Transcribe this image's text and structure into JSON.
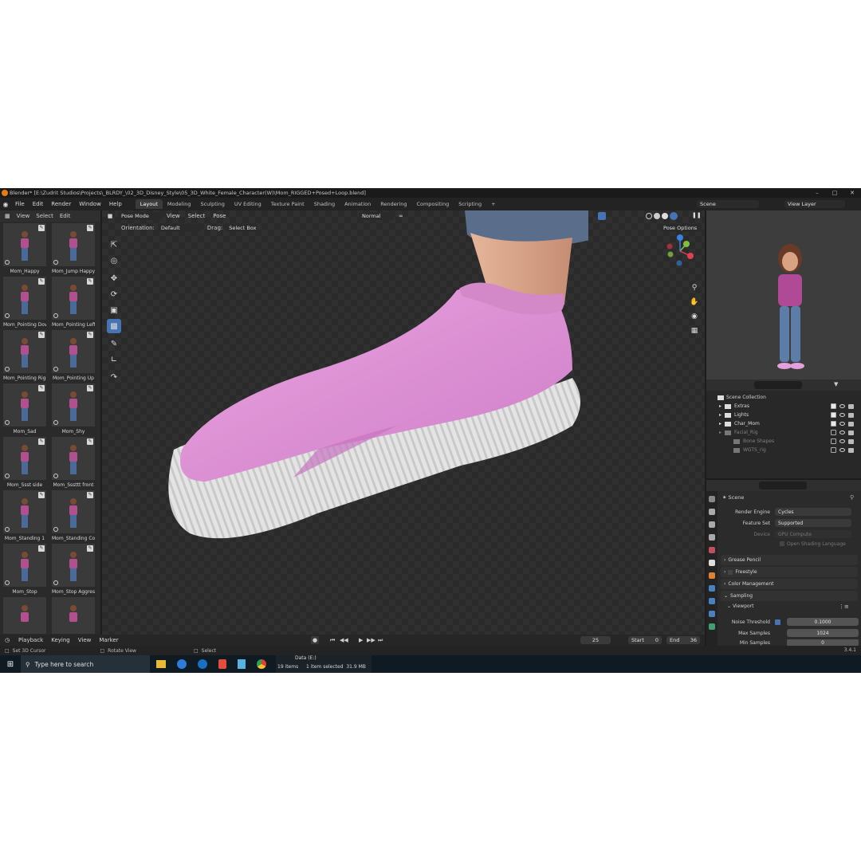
{
  "window": {
    "title": "Blender* [E:\\Zudrit Studios\\Projects\\_BLRDY_\\02_3D_Disney_Style\\05_3D_White_Female_Character(W)\\Mom_RIGGED+Posed+Loop.blend]"
  },
  "menu": {
    "items": [
      "File",
      "Edit",
      "Render",
      "Window",
      "Help"
    ],
    "workspaces": [
      "Layout",
      "Modeling",
      "Sculpting",
      "UV Editing",
      "Texture Paint",
      "Shading",
      "Animation",
      "Rendering",
      "Compositing",
      "Scripting"
    ],
    "active_workspace": "Layout",
    "add_tab": "+",
    "scene": "Scene",
    "view_layer": "View Layer"
  },
  "assets": {
    "menu": [
      "View",
      "Select",
      "Edit"
    ],
    "items": [
      "Mom_Happy",
      "Mom_Jump Happy",
      "Mom_Pointing Down",
      "Mom_Pointing Left",
      "Mom_Pointing Right",
      "Mom_Pointing Up",
      "Mom_Sad",
      "Mom_Shy",
      "Mom_Ssst side",
      "Mom_Sssttt front",
      "Mom_Standing 1",
      "Mom_Standing Co...",
      "Mom_Stop",
      "Mom_Stop Aggres..."
    ]
  },
  "viewport": {
    "mode": "Pose Mode",
    "menu": [
      "View",
      "Select",
      "Pose"
    ],
    "orientation_label": "Orientation:",
    "orientation_value": "Default",
    "drag_label": "Drag:",
    "drag_value": "Select Box",
    "transform": "Normal",
    "pose_options": "Pose Options",
    "gizmo_axes": [
      "X",
      "Y",
      "Z"
    ],
    "tools": [
      "cursor-select",
      "3d-cursor",
      "move",
      "rotate",
      "scale",
      "transform",
      "annotate",
      "measure",
      "bone-tool"
    ]
  },
  "outliner": {
    "root": "Scene Collection",
    "items": [
      {
        "name": "Extras",
        "active": true
      },
      {
        "name": "Lights",
        "active": true
      },
      {
        "name": "Char_Mom",
        "active": true
      },
      {
        "name": "Facial_Rig",
        "active": false
      },
      {
        "name": "Bone Shapes",
        "active": false
      },
      {
        "name": "WGTS_rig",
        "active": false
      }
    ]
  },
  "properties": {
    "context": "Scene",
    "rows": [
      {
        "label": "Render Engine",
        "value": "Cycles"
      },
      {
        "label": "Feature Set",
        "value": "Supported"
      },
      {
        "label": "Device",
        "value": "GPU Compute"
      }
    ],
    "osl": "Open Shading Language",
    "sections": [
      "Grease Pencil",
      "Freestyle",
      "Color Management",
      "Sampling"
    ],
    "viewport_sub": "Viewport",
    "noise_threshold_label": "Noise Threshold",
    "noise_threshold": "0.1000",
    "max_samples_label": "Max Samples",
    "max_samples": "1024",
    "min_samples_label": "Min Samples",
    "min_samples": "0"
  },
  "timeline": {
    "menu": [
      "Playback",
      "Keying",
      "View",
      "Marker"
    ],
    "current_frame": "25",
    "start_label": "Start",
    "start": "0",
    "end_label": "End",
    "end": "36"
  },
  "status": {
    "left": "Set 3D Cursor",
    "middle": "Rotate View",
    "right_action": "Select",
    "version": "3.4.1"
  },
  "taskbar": {
    "search_placeholder": "Type here to search",
    "explorer_drive": "Data (E:)",
    "explorer_count": "19 items",
    "explorer_selected": "1 item selected  31.9 MB"
  },
  "colors": {
    "accent": "#4772b3",
    "shoe_pink": "#e49ad8",
    "sole_white": "#e8e8e8"
  }
}
